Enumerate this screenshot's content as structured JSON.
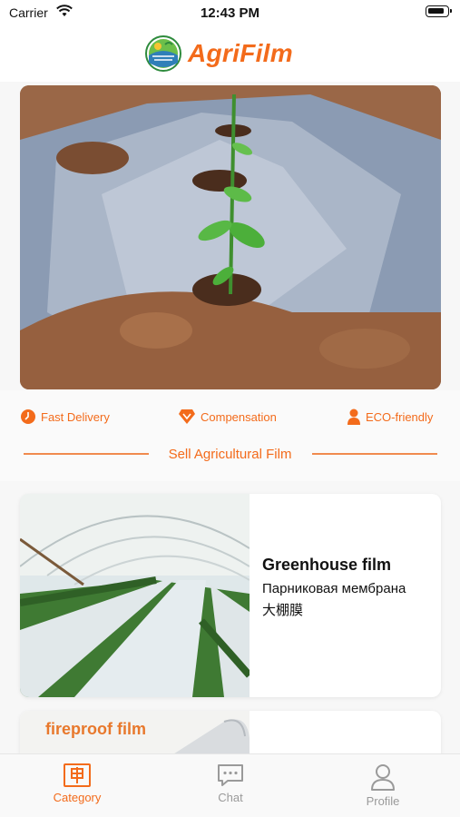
{
  "status_bar": {
    "carrier": "Carrier",
    "time": "12:43 PM"
  },
  "header": {
    "brand": "AgriFilm"
  },
  "features": [
    {
      "label": "Fast Delivery",
      "icon": "clock-icon"
    },
    {
      "label": "Compensation",
      "icon": "diamond-icon"
    },
    {
      "label": "ECO-friendly",
      "icon": "person-icon"
    }
  ],
  "section": {
    "title": "Sell Agricultural Film"
  },
  "products": [
    {
      "title": "Greenhouse film",
      "subtitle_ru": "Парниковая мембрана",
      "subtitle_zh": "大棚膜"
    },
    {
      "image_text": "fireproof film"
    }
  ],
  "tabbar": [
    {
      "label": "Category",
      "icon": "category-icon",
      "active": true
    },
    {
      "label": "Chat",
      "icon": "chat-icon",
      "active": false
    },
    {
      "label": "Profile",
      "icon": "profile-icon",
      "active": false
    }
  ],
  "colors": {
    "accent": "#f36b1b",
    "inactive": "#9a9a9a"
  }
}
